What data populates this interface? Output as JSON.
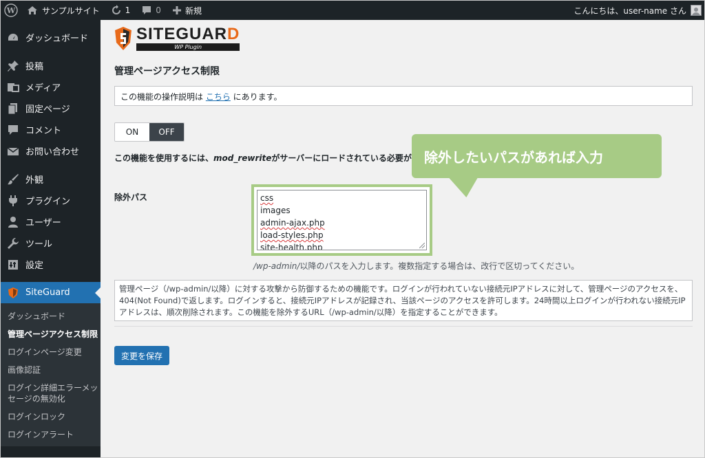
{
  "adminbar": {
    "site_name": "サンプルサイト",
    "updates_count": "1",
    "comments_count": "0",
    "new_label": "新規",
    "greeting": "こんにちは、user-name さん"
  },
  "sidebar": {
    "items": [
      {
        "label": "ダッシュボード",
        "icon": "dashboard-icon"
      },
      {
        "label": "投稿",
        "icon": "pin-icon"
      },
      {
        "label": "メディア",
        "icon": "media-icon"
      },
      {
        "label": "固定ページ",
        "icon": "page-icon"
      },
      {
        "label": "コメント",
        "icon": "comment-icon"
      },
      {
        "label": "お問い合わせ",
        "icon": "mail-icon"
      },
      {
        "label": "外観",
        "icon": "brush-icon"
      },
      {
        "label": "プラグイン",
        "icon": "plugin-icon"
      },
      {
        "label": "ユーザー",
        "icon": "user-icon"
      },
      {
        "label": "ツール",
        "icon": "wrench-icon"
      },
      {
        "label": "設定",
        "icon": "settings-icon"
      },
      {
        "label": "SiteGuard",
        "icon": "siteguard-icon"
      }
    ],
    "submenu": [
      "ダッシュボード",
      "管理ページアクセス制限",
      "ログインページ変更",
      "画像認証",
      "ログイン詳細エラーメッセージの無効化",
      "ログインロック",
      "ログインアラート"
    ]
  },
  "logo": {
    "text_main": "SITEGUAR",
    "text_d": "D",
    "sub": "WP Plugin"
  },
  "page": {
    "title": "管理ページアクセス制限",
    "notice_pre": "この機能の操作説明は ",
    "notice_link": "こちら",
    "notice_post": " にあります。",
    "toggle_on": "ON",
    "toggle_off": "OFF",
    "req_pre": "この機能を使用するには、",
    "req_mod": "mod_rewrite",
    "req_post": "がサーバーにロードされている必要があり",
    "callout": "除外したいパスがあれば入力",
    "exclude_label": "除外パス",
    "exclude_paths": [
      "css",
      "images",
      "admin-ajax.php",
      "load-styles.php",
      "site-health.php"
    ],
    "hint_path": "/wp-admin/",
    "hint_rest": "以降のパスを入力します。複数指定する場合は、改行で区切ってください。",
    "description": "管理ページ（/wp-admin/以降）に対する攻撃から防御するための機能です。ログインが行われていない接続元IPアドレスに対して、管理ページのアクセスを、404(Not Found)で返します。ログインすると、接続元IPアドレスが記録され、当該ページのアクセスを許可します。24時間以上ログインが行われない接続元IPアドレスは、順次削除されます。この機能を除外するURL（/wp-admin/以降）を指定することができます。",
    "save_label": "変更を保存"
  },
  "colors": {
    "accent": "#2271b1",
    "callout": "#a7cb85",
    "logo_d": "#e86a1a"
  }
}
